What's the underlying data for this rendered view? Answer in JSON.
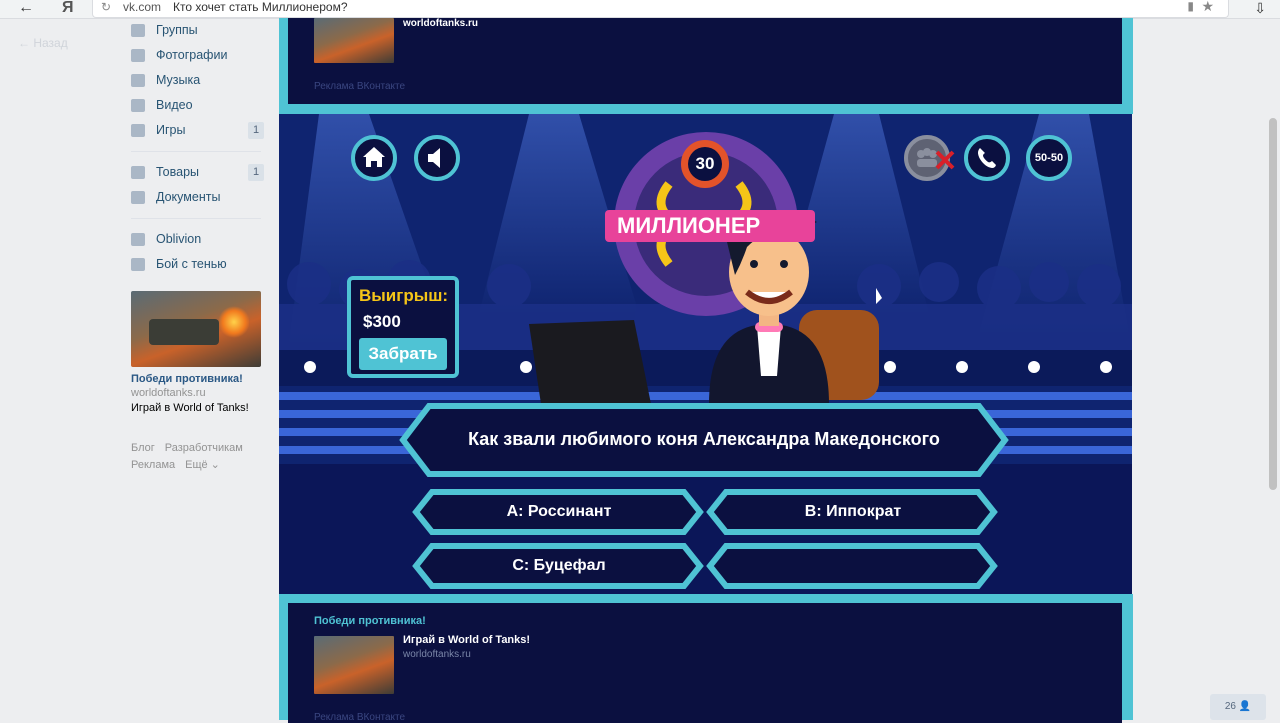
{
  "browser": {
    "back_icon": "←",
    "yandex_logo": "Я",
    "domain": "vk.com",
    "page_title": "Кто хочет стать Миллионером?",
    "reload_icon": "↻",
    "bookmark_icon": "★",
    "download_icon": "⇩"
  },
  "left": {
    "back_label": "← Назад",
    "nav": [
      {
        "label": "Группы",
        "icon": "groups-icon",
        "badge": ""
      },
      {
        "label": "Фотографии",
        "icon": "camera-icon",
        "badge": ""
      },
      {
        "label": "Музыка",
        "icon": "music-icon",
        "badge": ""
      },
      {
        "label": "Видео",
        "icon": "video-icon",
        "badge": ""
      },
      {
        "label": "Игры",
        "icon": "gamepad-icon",
        "badge": "1"
      }
    ],
    "nav2": [
      {
        "label": "Товары",
        "icon": "bag-icon",
        "badge": "1"
      },
      {
        "label": "Документы",
        "icon": "document-icon",
        "badge": ""
      }
    ],
    "nav3": [
      {
        "label": "Oblivion",
        "icon": "crown-icon"
      },
      {
        "label": "Бой с тенью",
        "icon": "apps-icon"
      }
    ],
    "ad": {
      "title": "Победи противника!",
      "domain": "worldoftanks.ru",
      "text": "Играй в World of Tanks!"
    },
    "footer": [
      "Блог",
      "Разработчикам",
      "Реклама",
      "Ещё ⌄"
    ]
  },
  "game_top_ad": {
    "domain": "worldoftanks.ru",
    "label": "Реклама ВКонтакте"
  },
  "game": {
    "timer": "30",
    "logo": "МИЛЛИОНЕР",
    "lifeline_5050": "50-50",
    "win_label": "Выигрыш:",
    "win_value": "$300",
    "take_button": "Забрать",
    "question": "Как звали любимого коня Александра Македонского",
    "answers": {
      "a": "A: Россинант",
      "b": "B: Иппократ",
      "c": "C: Буцефал",
      "d": ""
    }
  },
  "game_bottom_ad": {
    "title": "Победи противника!",
    "headline": "Играй в World of Tanks!",
    "domain": "worldoftanks.ru",
    "label": "Реклама ВКонтакте"
  },
  "pager": "26"
}
